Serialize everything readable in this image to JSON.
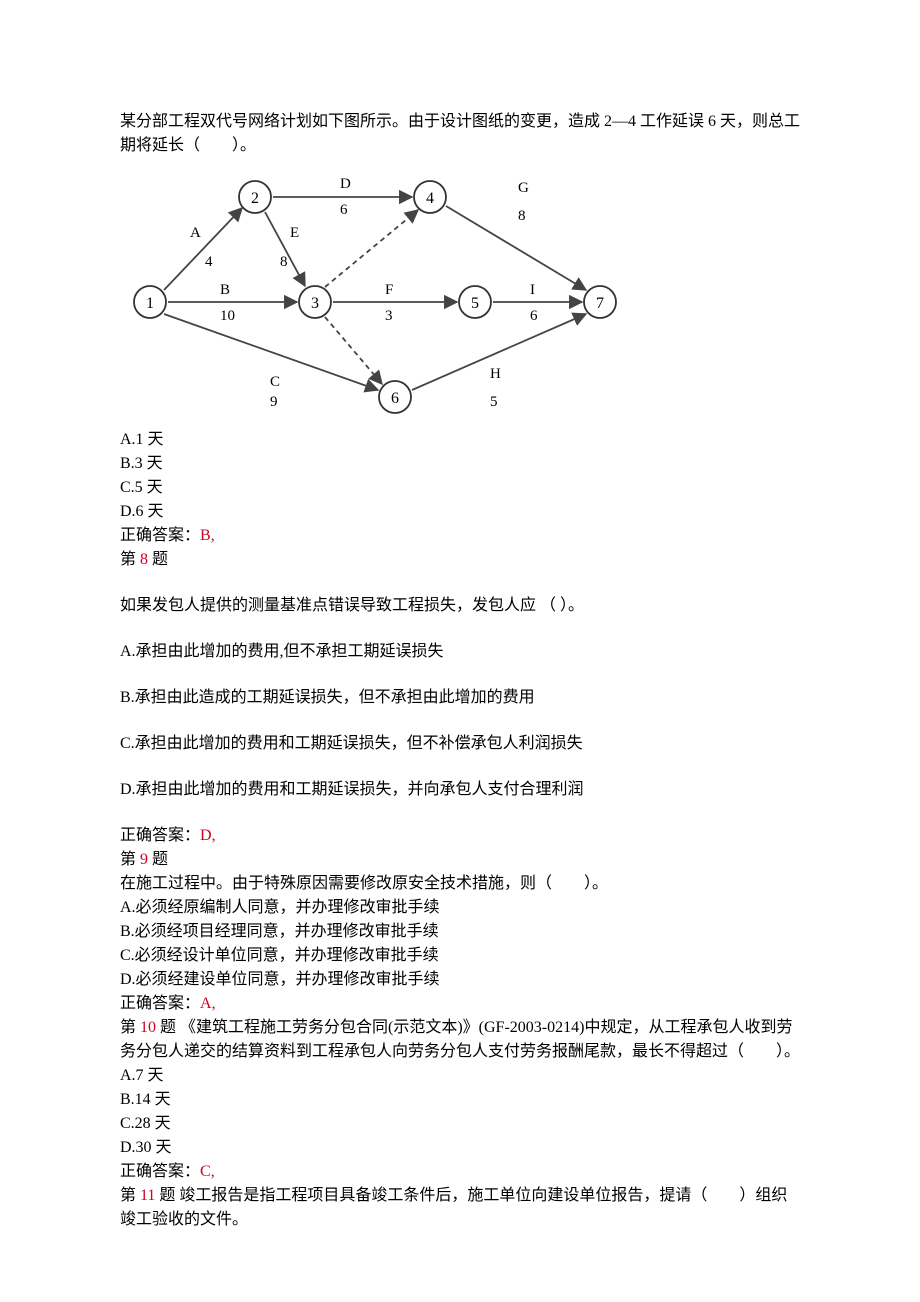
{
  "q7": {
    "stem": "某分部工程双代号网络计划如下图所示。由于设计图纸的变更，造成 2—4 工作延误 6 天，则总工期将延长（　　）。",
    "optA": "A.1 天",
    "optB": "B.3 天",
    "optC": "C.5 天",
    "optD": "D.6 天",
    "ansLabel": "正确答案：",
    "ansVal": "B,"
  },
  "q8": {
    "header1": "第 ",
    "num": "8",
    "header2": " 题",
    "stem": "如果发包人提供的测量基准点错误导致工程损失，发包人应 （ ）。",
    "optA": "A.承担由此增加的费用,但不承担工期延误损失",
    "optB": "B.承担由此造成的工期延误损失，但不承担由此增加的费用",
    "optC": "C.承担由此增加的费用和工期延误损失，但不补偿承包人利润损失",
    "optD": "D.承担由此增加的费用和工期延误损失，并向承包人支付合理利润",
    "ansLabel": "正确答案：",
    "ansVal": "D,"
  },
  "q9": {
    "header1": "第 ",
    "num": "9",
    "header2": " 题",
    "stem": "在施工过程中。由于特殊原因需要修改原安全技术措施，则（　　）。",
    "optA": "A.必须经原编制人同意，并办理修改审批手续",
    "optB": "B.必须经项目经理同意，并办理修改审批手续",
    "optC": "C.必须经设计单位同意，并办理修改审批手续",
    "optD": "D.必须经建设单位同意，并办理修改审批手续",
    "ansLabel": "正确答案：",
    "ansVal": "A,"
  },
  "q10": {
    "header1": "第 ",
    "num": "10",
    "header2": " 题 《建筑工程施工劳务分包合同(示范文本)》(GF-2003-0214)中规定，从工程承包人收到劳务分包人递交的结算资料到工程承包人向劳务分包人支付劳务报酬尾款，最长不得超过（　　）。",
    "optA": "A.7 天",
    "optB": "B.14 天",
    "optC": "C.28 天",
    "optD": "D.30 天",
    "ansLabel": "正确答案：",
    "ansVal": "C,"
  },
  "q11": {
    "header1": "第 ",
    "num": "11",
    "header2": " 题 竣工报告是指工程项目具备竣工条件后，施工单位向建设单位报告，提请（　　）组织竣工验收的文件。"
  },
  "chart_data": {
    "type": "activity-on-arrow-network",
    "nodes": [
      1,
      2,
      3,
      4,
      5,
      6,
      7
    ],
    "activities": [
      {
        "name": "A",
        "from": 1,
        "to": 2,
        "duration": 4
      },
      {
        "name": "B",
        "from": 1,
        "to": 3,
        "duration": 10
      },
      {
        "name": "C",
        "from": 1,
        "to": 6,
        "duration": 9
      },
      {
        "name": "D",
        "from": 2,
        "to": 4,
        "duration": 6
      },
      {
        "name": "E",
        "from": 2,
        "to": 3,
        "duration": 8
      },
      {
        "name": "F",
        "from": 3,
        "to": 5,
        "duration": 3
      },
      {
        "name": "G",
        "from": 4,
        "to": 7,
        "duration": 8
      },
      {
        "name": "H",
        "from": 6,
        "to": 7,
        "duration": 5
      },
      {
        "name": "I",
        "from": 5,
        "to": 7,
        "duration": 6
      }
    ],
    "dummy_activities": [
      {
        "from": 3,
        "to": 4
      },
      {
        "from": 3,
        "to": 6
      }
    ]
  }
}
